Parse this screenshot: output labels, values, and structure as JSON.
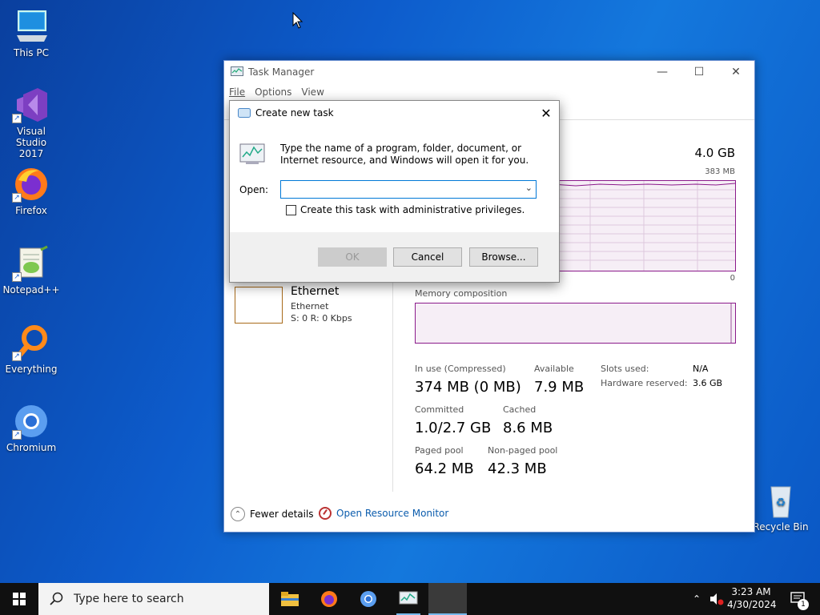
{
  "desktop": {
    "icons": [
      {
        "label": "This PC"
      },
      {
        "label": "Visual Studio 2017"
      },
      {
        "label": "Firefox"
      },
      {
        "label": "Notepad++"
      },
      {
        "label": "Everything"
      },
      {
        "label": "Chromium"
      },
      {
        "label": "Recycle Bin"
      }
    ]
  },
  "task_manager": {
    "title": "Task Manager",
    "menu": [
      "File",
      "Options",
      "View"
    ],
    "memory_total": "4.0 GB",
    "memory_max": "383 MB",
    "axis_zero": "0",
    "composition_label": "Memory composition",
    "ethernet": {
      "title": "Ethernet",
      "sub": "Ethernet",
      "rate": "S: 0 R: 0 Kbps"
    },
    "stats": {
      "in_use_label": "In use (Compressed)",
      "in_use_value": "374 MB (0 MB)",
      "available_label": "Available",
      "available_value": "7.9 MB",
      "slots_label": "Slots used:",
      "slots_value": "N/A",
      "hw_label": "Hardware reserved:",
      "hw_value": "3.6 GB",
      "committed_label": "Committed",
      "committed_value": "1.0/2.7 GB",
      "cached_label": "Cached",
      "cached_value": "8.6 MB",
      "paged_label": "Paged pool",
      "paged_value": "64.2 MB",
      "nonpaged_label": "Non-paged pool",
      "nonpaged_value": "42.3 MB"
    },
    "fewer_details": "Fewer details",
    "open_resource_monitor": "Open Resource Monitor"
  },
  "dialog": {
    "title": "Create new task",
    "description": "Type the name of a program, folder, document, or Internet resource, and Windows will open it for you.",
    "open_label": "Open:",
    "open_value": "",
    "admin_checkbox_label": "Create this task with administrative privileges.",
    "ok": "OK",
    "cancel": "Cancel",
    "browse": "Browse..."
  },
  "taskbar": {
    "search_placeholder": "Type here to search",
    "time": "3:23 AM",
    "date": "4/30/2024",
    "notification_count": "1"
  },
  "colors": {
    "memory_accent": "#8b1a8b",
    "desktop_blue": "#0d5ccc",
    "link_blue": "#0b5cad"
  }
}
